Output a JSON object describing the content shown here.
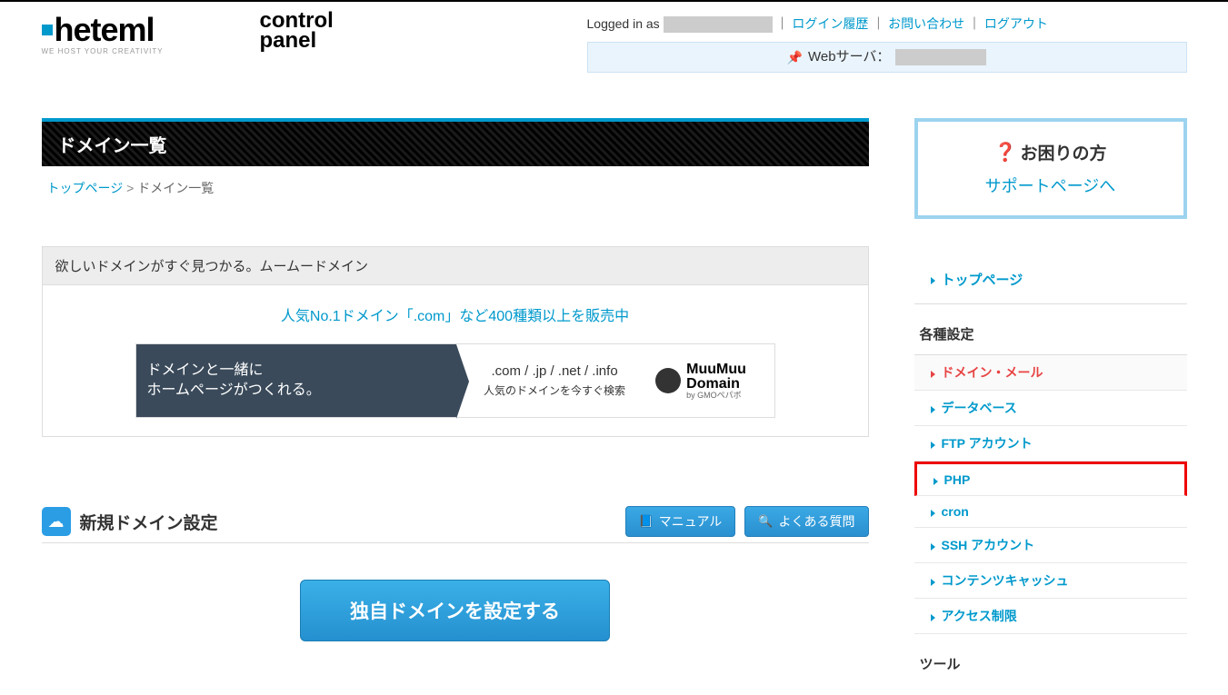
{
  "header": {
    "tagline": "WE HOST YOUR CREATIVITY",
    "logged_in_prefix": "Logged in as ",
    "separator": " ｜ ",
    "links": {
      "login_history": "ログイン履歴",
      "contact": "お問い合わせ",
      "logout": "ログアウト"
    },
    "server_bar": {
      "pin": "📌",
      "label": "Webサーバ："
    }
  },
  "page": {
    "title": "ドメイン一覧",
    "breadcrumb": {
      "top": "トップページ",
      "sep": ">",
      "current": "ドメイン一覧"
    }
  },
  "promo": {
    "head": "欲しいドメインがすぐ見つかる。ムームードメイン",
    "link_text": "人気No.1ドメイン「.com」など400種類以上を販売中",
    "banner_left_line1": "ドメインと一緒に",
    "banner_left_line2": "ホームページがつくれる。",
    "domain_list": ".com / .jp / .net / .info",
    "domain_sub": "人気のドメインを今すぐ検索",
    "muu_big": "MuuMuu\nDomain",
    "muu_small": "by GMOペパボ"
  },
  "section": {
    "title": "新規ドメイン設定",
    "manual_btn": "マニュアル",
    "faq_btn": "よくある質問",
    "big_btn": "独自ドメインを設定する"
  },
  "help": {
    "title": "お困りの方",
    "link": "サポートページへ"
  },
  "sidebar": {
    "top_link": "トップページ",
    "settings_head": "各種設定",
    "settings_items": [
      {
        "label": "ドメイン・メール",
        "active": true,
        "highlighted": false
      },
      {
        "label": "データベース",
        "active": false,
        "highlighted": false
      },
      {
        "label": "FTP アカウント",
        "active": false,
        "highlighted": false
      },
      {
        "label": "PHP",
        "active": false,
        "highlighted": true
      },
      {
        "label": "cron",
        "active": false,
        "highlighted": false
      },
      {
        "label": "SSH アカウント",
        "active": false,
        "highlighted": false
      },
      {
        "label": "コンテンツキャッシュ",
        "active": false,
        "highlighted": false
      },
      {
        "label": "アクセス制限",
        "active": false,
        "highlighted": false
      }
    ],
    "tools_head": "ツール"
  }
}
